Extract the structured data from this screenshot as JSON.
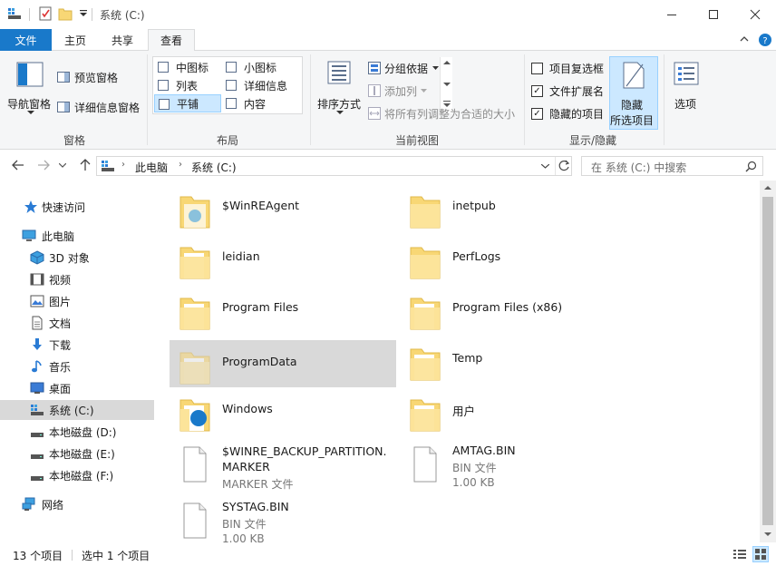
{
  "title": "系统 (C:)",
  "tabs": {
    "file": "文件",
    "home": "主页",
    "share": "共享",
    "view": "查看"
  },
  "ribbon": {
    "pane": {
      "nav_pane": "导航窗格",
      "preview_pane": "预览窗格",
      "details_pane": "详细信息窗格",
      "group": "窗格"
    },
    "layout": {
      "items": [
        "中图标",
        "小图标",
        "列表",
        "详细信息",
        "平铺",
        "内容"
      ],
      "group": "布局"
    },
    "current_view": {
      "sort": "排序方式",
      "group_by": "分组依据",
      "add_column": "添加列",
      "fit_columns": "将所有列调整为合适的大小",
      "group": "当前视图"
    },
    "show_hide": {
      "item_checkboxes": "项目复选框",
      "file_extensions": "文件扩展名",
      "hidden_items": "隐藏的项目",
      "hide_selected_1": "隐藏",
      "hide_selected_2": "所选项目",
      "group": "显示/隐藏"
    },
    "options": "选项"
  },
  "address": {
    "crumb1": "此电脑",
    "crumb2": "系统 (C:)",
    "search_placeholder": "在 系统 (C:) 中搜索"
  },
  "sidebar": {
    "quick_access": "快速访问",
    "this_pc": "此电脑",
    "items": [
      "3D 对象",
      "视频",
      "图片",
      "文档",
      "下载",
      "音乐",
      "桌面",
      "系统 (C:)",
      "本地磁盘 (D:)",
      "本地磁盘 (E:)",
      "本地磁盘 (F:)"
    ],
    "network": "网络"
  },
  "files": [
    {
      "name": "$WinREAgent"
    },
    {
      "name": "inetpub"
    },
    {
      "name": "leidian"
    },
    {
      "name": "PerfLogs"
    },
    {
      "name": "Program Files"
    },
    {
      "name": "Program Files (x86)"
    },
    {
      "name": "ProgramData"
    },
    {
      "name": "Temp"
    },
    {
      "name": "Windows"
    },
    {
      "name": "用户"
    },
    {
      "name": "$WINRE_BACKUP_PARTITION.MARKER",
      "type": "MARKER 文件"
    },
    {
      "name": "AMTAG.BIN",
      "type": "BIN 文件",
      "size": "1.00 KB"
    },
    {
      "name": "SYSTAG.BIN",
      "type": "BIN 文件",
      "size": "1.00 KB"
    }
  ],
  "status": {
    "count": "13 个项目",
    "selected": "选中 1 个项目"
  },
  "colors": {
    "accent": "#1979ca",
    "folder": "#f8d775",
    "selection": "#cce8ff"
  }
}
